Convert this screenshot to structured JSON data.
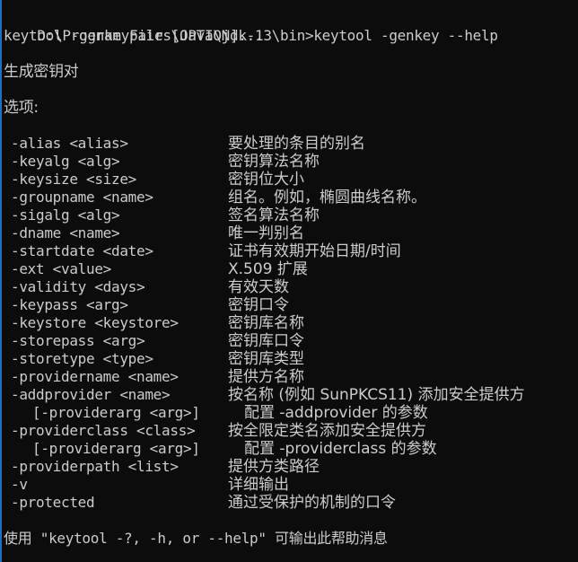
{
  "console": {
    "background": "#0c0c0c",
    "foreground": "#cccccc",
    "prompt": "D:\\Program Files\\Java\\jdk-13\\bin>",
    "command": "keytool -genkey --help",
    "usage": "keytool -genkeypair [OPTION]...",
    "description": "生成密钥对",
    "options_heading": "选项:",
    "options": [
      {
        "name": "-alias <alias>",
        "desc": "要处理的条目的别名"
      },
      {
        "name": "-keyalg <alg>",
        "desc": "密钥算法名称"
      },
      {
        "name": "-keysize <size>",
        "desc": "密钥位大小"
      },
      {
        "name": "-groupname <name>",
        "desc": "组名。例如，椭圆曲线名称。"
      },
      {
        "name": "-sigalg <alg>",
        "desc": "签名算法名称"
      },
      {
        "name": "-dname <name>",
        "desc": "唯一判别名"
      },
      {
        "name": "-startdate <date>",
        "desc": "证书有效期开始日期/时间"
      },
      {
        "name": "-ext <value>",
        "desc": "X.509 扩展"
      },
      {
        "name": "-validity <days>",
        "desc": "有效天数"
      },
      {
        "name": "-keypass <arg>",
        "desc": "密钥口令"
      },
      {
        "name": "-keystore <keystore>",
        "desc": "密钥库名称"
      },
      {
        "name": "-storepass <arg>",
        "desc": "密钥库口令"
      },
      {
        "name": "-storetype <type>",
        "desc": "密钥库类型"
      },
      {
        "name": "-providername <name>",
        "desc": "提供方名称"
      },
      {
        "name": "-addprovider <name>",
        "desc": "按名称 (例如 SunPKCS11) 添加安全提供方"
      },
      {
        "name": "[-providerarg <arg>]",
        "desc": "配置 -addprovider 的参数",
        "sub": true
      },
      {
        "name": "-providerclass <class>",
        "desc": "按全限定类名添加安全提供方"
      },
      {
        "name": "[-providerarg <arg>]",
        "desc": "配置 -providerclass 的参数",
        "sub": true
      },
      {
        "name": "-providerpath <list>",
        "desc": "提供方类路径"
      },
      {
        "name": "-v",
        "desc": "详细输出"
      },
      {
        "name": "-protected",
        "desc": "通过受保护的机制的口令"
      }
    ],
    "footer": "使用 \"keytool -?, -h, or --help\" 可输出此帮助消息"
  }
}
